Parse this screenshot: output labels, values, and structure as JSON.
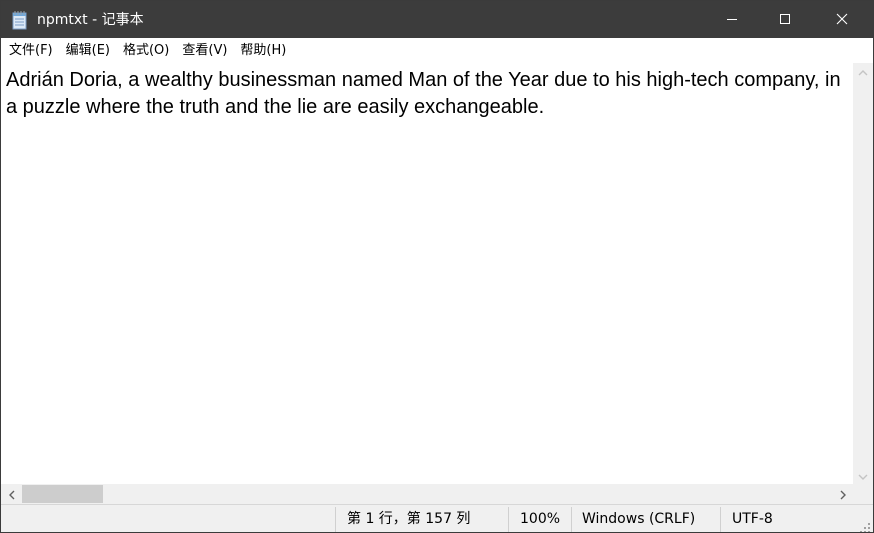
{
  "window": {
    "title": "npmtxt - 记事本",
    "icon": "notepad-icon",
    "controls": {
      "minimize": "minimize-icon",
      "maximize": "maximize-icon",
      "close": "close-icon"
    }
  },
  "menu": {
    "items": [
      {
        "label": "文件(F)"
      },
      {
        "label": "编辑(E)"
      },
      {
        "label": "格式(O)"
      },
      {
        "label": "查看(V)"
      },
      {
        "label": "帮助(H)"
      }
    ]
  },
  "editor": {
    "content": "Adrián Doria, a wealthy businessman named Man of the Year due to his high-tech company, in a puzzle where the truth and the lie are easily exchangeable."
  },
  "statusbar": {
    "position": "第 1 行，第 157 列",
    "zoom": "100%",
    "line_ending": "Windows (CRLF)",
    "encoding": "UTF-8"
  },
  "colors": {
    "titlebar": "#3c3c3c",
    "chrome": "#f0f0f0",
    "scroll_thumb": "#cdcdcd"
  }
}
